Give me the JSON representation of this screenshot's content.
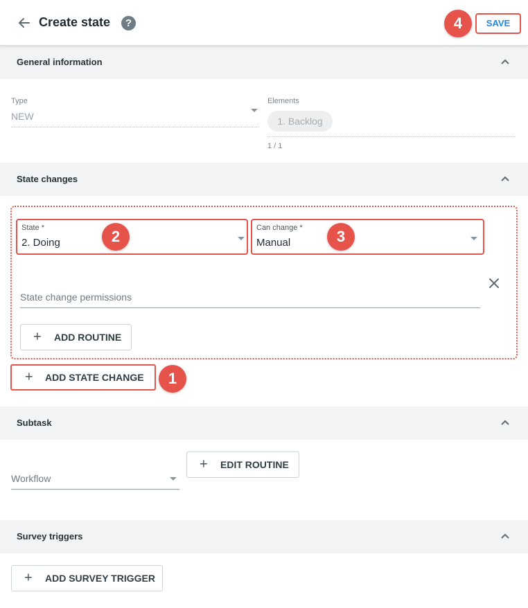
{
  "header": {
    "title": "Create state",
    "save_label": "SAVE",
    "help_glyph": "?"
  },
  "annotations": {
    "badge_1": "1",
    "badge_2": "2",
    "badge_3": "3",
    "badge_4": "4",
    "color": "#e5534b"
  },
  "general_information": {
    "title": "General information",
    "type_label": "Type",
    "type_value": "NEW",
    "elements_label": "Elements",
    "elements_chip": "1. Backlog",
    "elements_count": "1 / 1"
  },
  "state_changes": {
    "title": "State changes",
    "state_label": "State *",
    "state_value": "2. Doing",
    "can_change_label": "Can change *",
    "can_change_value": "Manual",
    "permissions_placeholder": "State change permissions",
    "add_routine_label": "ADD ROUTINE",
    "add_state_change_label": "ADD STATE CHANGE"
  },
  "subtask": {
    "title": "Subtask",
    "workflow_placeholder": "Workflow",
    "edit_routine_label": "EDIT ROUTINE"
  },
  "survey_triggers": {
    "title": "Survey triggers",
    "add_survey_trigger_label": "ADD SURVEY TRIGGER"
  },
  "icons": {
    "back": "arrow-left-icon",
    "help": "help-circle-icon",
    "collapse": "chevron-up-icon",
    "dropdown": "caret-down-icon",
    "plus": "plus-icon",
    "close": "close-icon"
  },
  "colors": {
    "accent": "#1e88e5",
    "highlight": "#e5534b",
    "section_bg": "#f2f3f4"
  }
}
